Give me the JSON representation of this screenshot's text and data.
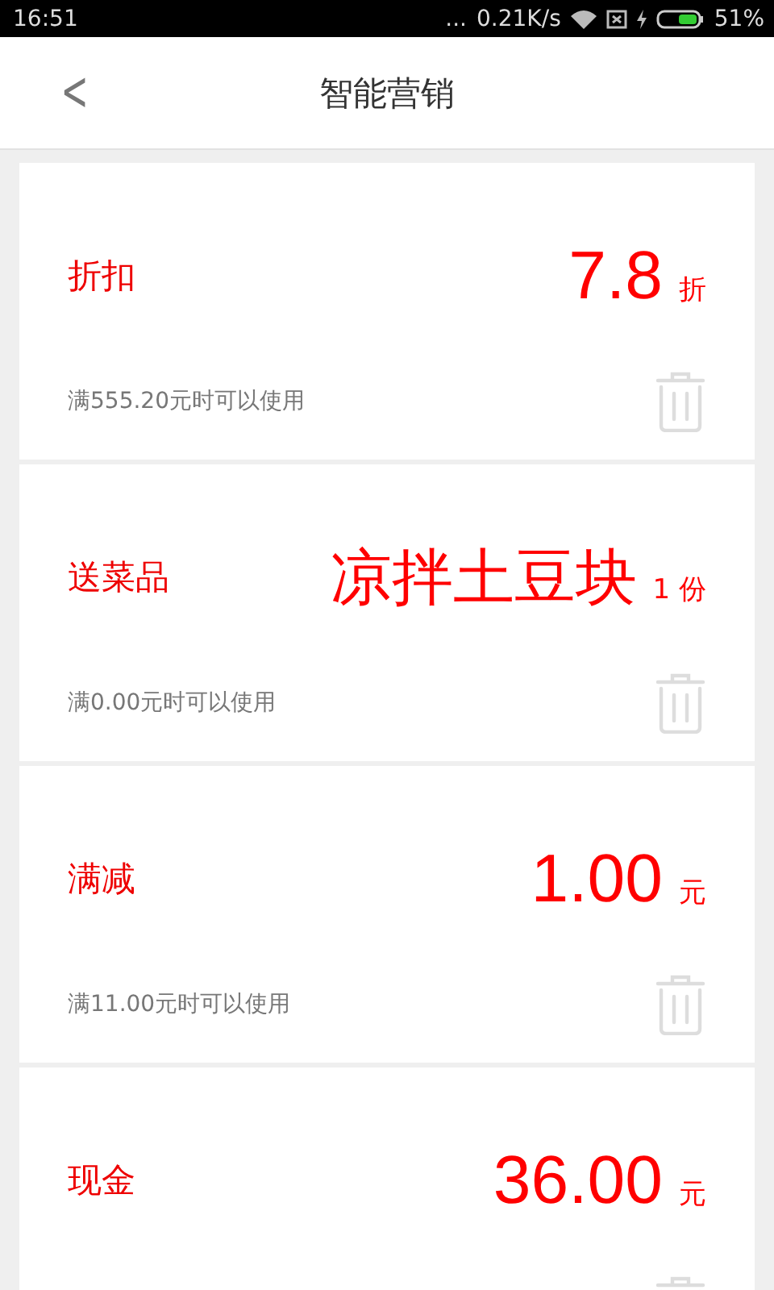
{
  "status_bar": {
    "time": "16:51",
    "more": "...",
    "speed": "0.21K/s",
    "battery": "51%"
  },
  "header": {
    "back": "<",
    "title": "智能营销"
  },
  "promotions": [
    {
      "label": "折扣",
      "value": "7.8",
      "unit": "折",
      "kind": "number",
      "condition": "满555.20元时可以使用"
    },
    {
      "label": "送菜品",
      "value": "凉拌土豆块",
      "unit": "1 份",
      "kind": "dish",
      "condition": "满0.00元时可以使用"
    },
    {
      "label": "满减",
      "value": "1.00",
      "unit": "元",
      "kind": "number",
      "condition": "满11.00元时可以使用"
    },
    {
      "label": "现金",
      "value": "36.00",
      "unit": "元",
      "kind": "number"
    }
  ]
}
